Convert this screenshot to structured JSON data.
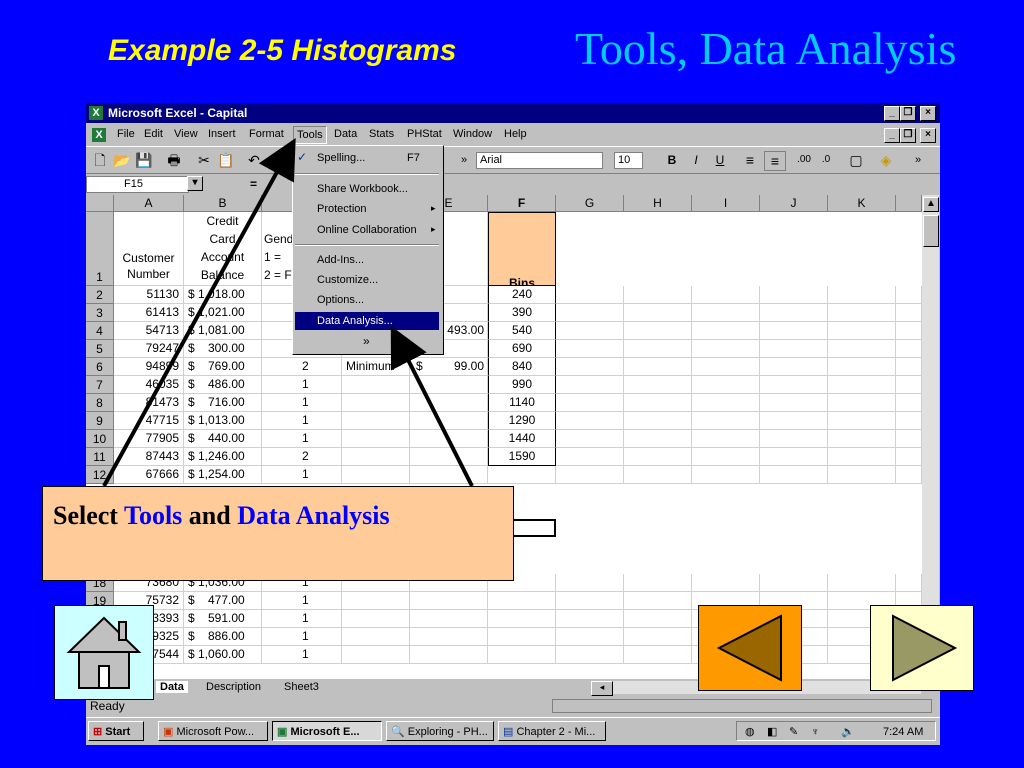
{
  "slide": {
    "title_left": "Example 2-5 Histograms",
    "title_right": "Tools, Data Analysis"
  },
  "excel": {
    "window_title": "Microsoft Excel - Capital",
    "menus": [
      "File",
      "Edit",
      "View",
      "Insert",
      "Format",
      "Tools",
      "Data",
      "Stats",
      "PHStat",
      "Window",
      "Help"
    ],
    "font_name": "Arial",
    "font_size": "10",
    "name_box": "F15",
    "formula_eq": "=",
    "columns": [
      "A",
      "B",
      "C",
      "D",
      "E",
      "F",
      "G",
      "H",
      "I",
      "J",
      "K"
    ],
    "header_row": {
      "num": "1",
      "a_line1": "Customer",
      "a_line2": "Number",
      "b_line1": "Credit",
      "b_line2": "Card",
      "b_line3": "Account",
      "b_line4": "Balance",
      "c_line1": "Gend",
      "c_line2": "1 =",
      "c_line3": "2 = F",
      "f_label": "Bins"
    },
    "rows": [
      {
        "num": "2",
        "a": "51130",
        "b": "$ 1,018.00",
        "c": "",
        "f": "240"
      },
      {
        "num": "3",
        "a": "61413",
        "b": "$ 1,021.00",
        "c": "",
        "f": "390"
      },
      {
        "num": "4",
        "a": "54713",
        "b": "$ 1,081.00",
        "c": "",
        "f": "540"
      },
      {
        "num": "5",
        "a": "79247",
        "b": "$    300.00",
        "c": "",
        "f": "690"
      },
      {
        "num": "6",
        "a": "94899",
        "b": "$    769.00",
        "c": "2",
        "f": "840"
      },
      {
        "num": "7",
        "a": "46035",
        "b": "$    486.00",
        "c": "1",
        "f": "990"
      },
      {
        "num": "8",
        "a": "81473",
        "b": "$    716.00",
        "c": "1",
        "f": "1140"
      },
      {
        "num": "9",
        "a": "47715",
        "b": "$ 1,013.00",
        "c": "1",
        "f": "1290"
      },
      {
        "num": "10",
        "a": "77905",
        "b": "$    440.00",
        "c": "1",
        "f": "1440"
      },
      {
        "num": "11",
        "a": "87443",
        "b": "$ 1,246.00",
        "c": "2",
        "f": "1590"
      },
      {
        "num": "12",
        "a": "67666",
        "b": "$ 1,254.00",
        "c": "1",
        "f": ""
      },
      {
        "num": "18",
        "a": "73680",
        "b": "$ 1,036.00",
        "c": "1",
        "f": ""
      },
      {
        "num": "19",
        "a": "75732",
        "b": "$    477.00",
        "c": "1",
        "f": ""
      },
      {
        "num": "",
        "a": "3393",
        "b": "$    591.00",
        "c": "1",
        "f": ""
      },
      {
        "num": "",
        "a": "9325",
        "b": "$    886.00",
        "c": "1",
        "f": ""
      },
      {
        "num": "",
        "a": "7544",
        "b": "$ 1,060.00",
        "c": "1",
        "f": ""
      }
    ],
    "e4": "493.00",
    "d6": "Minimum",
    "e6_sym": "$",
    "e6": "99.00",
    "tools_menu": {
      "spelling": "Spelling...",
      "spelling_key": "F7",
      "share": "Share Workbook...",
      "protection": "Protection",
      "online": "Online Collaboration",
      "addins": "Add-Ins...",
      "customize": "Customize...",
      "options": "Options...",
      "data_analysis": "Data Analysis...",
      "more": "»"
    },
    "sheet_tabs": [
      "Data",
      "Description",
      "Sheet3"
    ],
    "status": "Ready",
    "taskbar": {
      "start": "Start",
      "items": [
        "Microsoft Pow...",
        "Microsoft E...",
        "Exploring - PH...",
        "Chapter 2 - Mi..."
      ],
      "clock": "7:24 AM"
    }
  },
  "callout": {
    "prefix": "Select ",
    "tools": "Tools",
    "and": " and ",
    "data_analysis": "Data Analysis"
  },
  "colors": {
    "background": "#0000ff",
    "title_left": "#ffff00",
    "title_right": "#00ccff",
    "callout_bg": "#ffcc99",
    "nav_arrow_bg": "#ff9900",
    "nav_next_bg": "#ffffcc",
    "nav_home_bg": "#ccffff"
  },
  "icons": [
    "home-icon",
    "left-arrow-icon",
    "right-arrow-icon"
  ]
}
